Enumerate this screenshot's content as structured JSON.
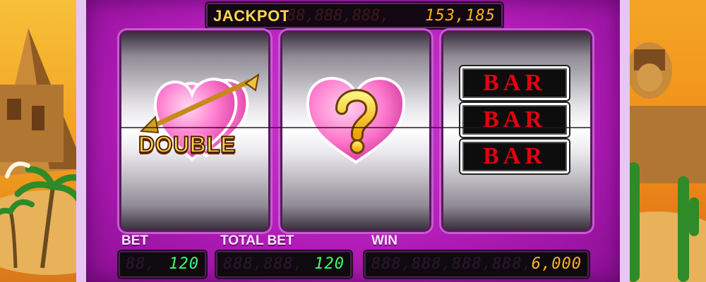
{
  "jackpot": {
    "label": "JACKPOT",
    "ghost_digits": "88,888,888,",
    "value": "153,185"
  },
  "reels": [
    {
      "symbol": "double-heart-arrow",
      "text": "DOUBLE"
    },
    {
      "symbol": "heart-question"
    },
    {
      "symbol": "triple-bar",
      "tiles": [
        "BAR",
        "BAR",
        "BAR"
      ]
    }
  ],
  "bet": {
    "label": "BET",
    "ghost_digits": "88,",
    "value": "120"
  },
  "total_bet": {
    "label": "TOTAL BET",
    "ghost_digits": "888,888,",
    "value": "120"
  },
  "win": {
    "label": "WIN",
    "ghost_digits": "888,888,888,888,",
    "value": "6,000"
  },
  "colors": {
    "cabinet": "#b21cb8",
    "jackpot_digits": "#ffb322",
    "bet_digits": "#3cff6a",
    "bar_text": "#e20012",
    "label_gold": "#ffd84a"
  }
}
